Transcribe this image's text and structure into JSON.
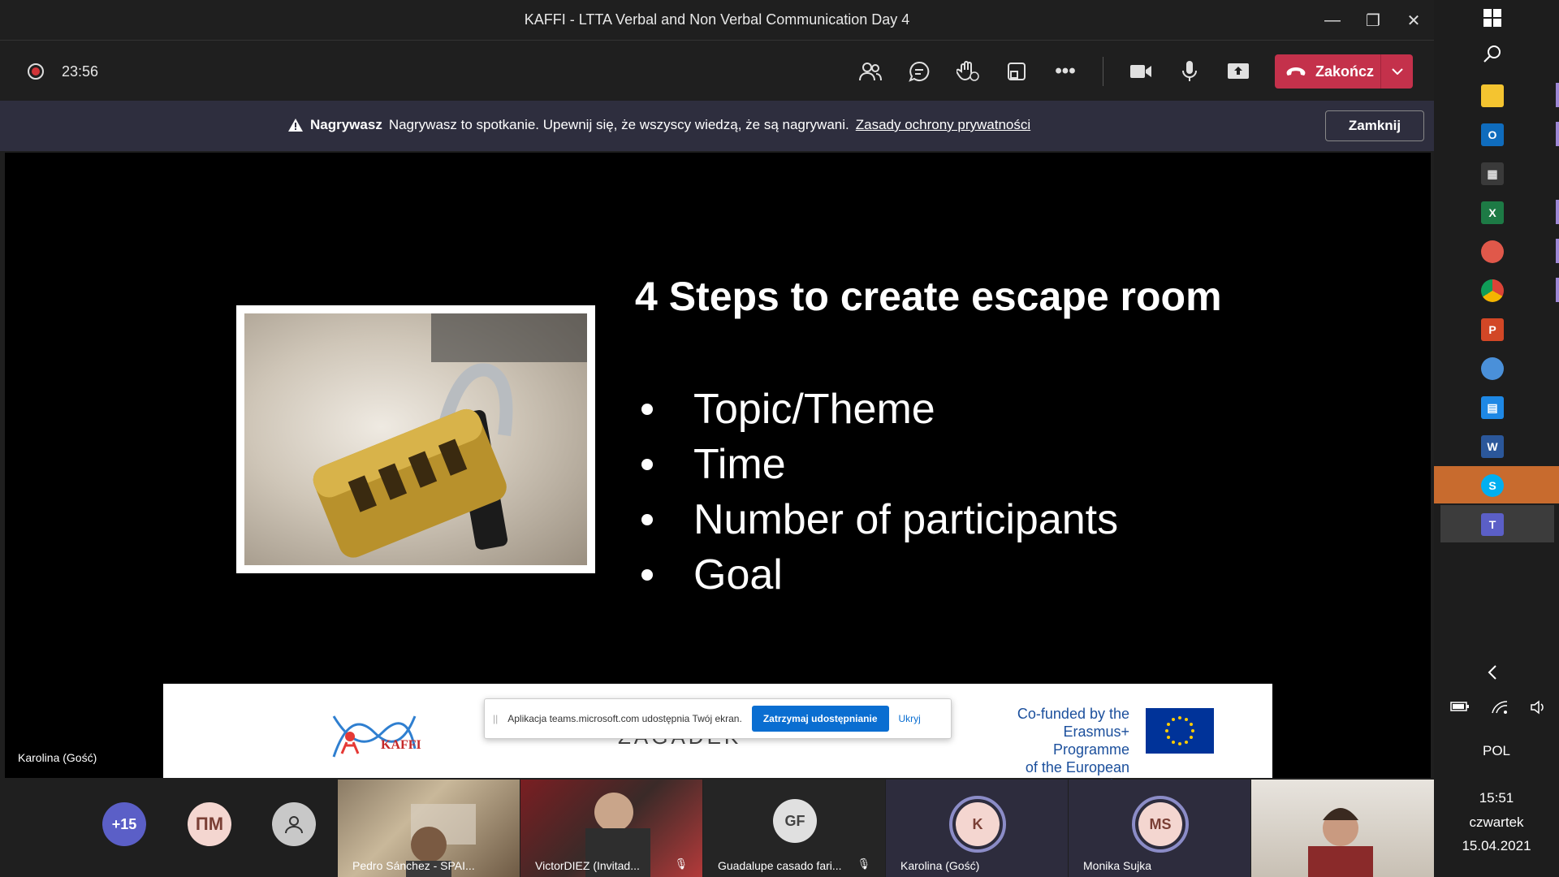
{
  "window": {
    "title": "KAFFI - LTTA Verbal and Non Verbal Communication Day 4"
  },
  "toolbar": {
    "timer": "23:56",
    "end_label": "Zakończ",
    "icons": [
      "participants-icon",
      "chat-icon",
      "raise-hand-icon",
      "rooms-icon",
      "more-icon",
      "camera-icon",
      "mic-icon",
      "share-icon"
    ]
  },
  "banner": {
    "bold": "Nagrywasz",
    "text": "Nagrywasz to spotkanie. Upewnij się, że wszyscy wiedzą, że są nagrywani.",
    "link": "Zasady ochrony prywatności",
    "close_label": "Zamknij"
  },
  "slide": {
    "title": "4 Steps to create escape room",
    "bullets": [
      "Topic/Theme",
      "Time",
      "Number of participants",
      "Goal"
    ],
    "footer": {
      "kaffi_logo_text": "KAFFI",
      "zagadek": "ZAGADEK",
      "cofunded": [
        "Co-funded by the",
        "Erasmus+ Programme",
        "of the European Union"
      ]
    }
  },
  "share_popup": {
    "text": "Aplikacja teams.microsoft.com udostępnia Twój ekran.",
    "stop_label": "Zatrzymaj udostępnianie",
    "hide_label": "Ukryj"
  },
  "presenter": {
    "name": "Karolina (Gość)"
  },
  "gallery": {
    "overflow": "+15",
    "initials_pm": "ПМ",
    "tiles": [
      {
        "name": "Pedro Sánchez - SPAI..."
      },
      {
        "name": "VictorDIEZ (Invitad..."
      },
      {
        "name": "Guadalupe casado fari...",
        "initials": "GF"
      },
      {
        "name": "Karolina (Gość)",
        "initials": "K"
      },
      {
        "name": "Monika Sujka",
        "initials": "MS"
      }
    ]
  },
  "taskbar": {
    "language": "POL",
    "time": "15:51",
    "day": "czwartek",
    "date": "15.04.2021"
  },
  "colors": {
    "accent_red": "#c4314b",
    "teams_purple": "#6264a7",
    "banner_bg": "#2e2e3e"
  }
}
